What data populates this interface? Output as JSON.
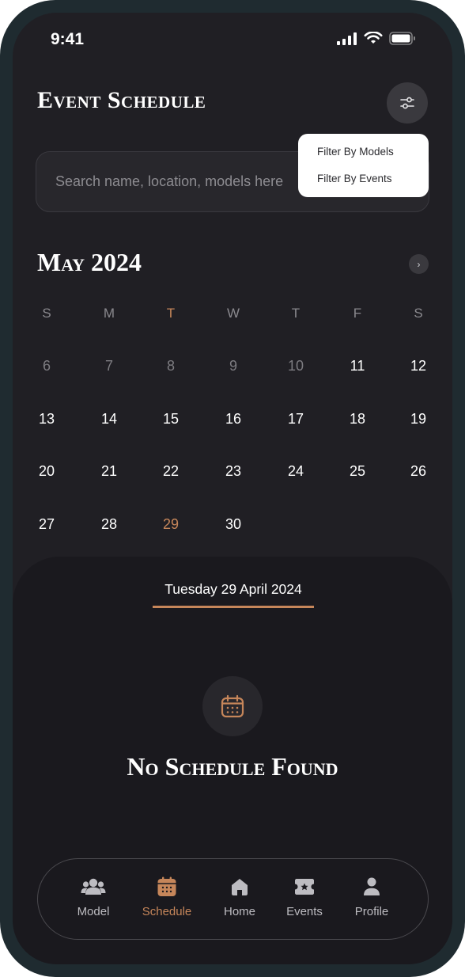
{
  "status_bar": {
    "time": "9:41"
  },
  "header": {
    "title": "Event Schedule"
  },
  "search": {
    "placeholder": "Search name, location, models here"
  },
  "filter_menu": {
    "items": [
      "Filter By Models",
      "Filter By Events"
    ]
  },
  "calendar": {
    "month_label": "May 2024",
    "weekdays": [
      "S",
      "M",
      "T",
      "W",
      "T",
      "F",
      "S"
    ],
    "today_weekday_index": 2,
    "weeks": [
      [
        "6",
        "7",
        "8",
        "9",
        "10",
        "11",
        "12"
      ],
      [
        "13",
        "14",
        "15",
        "16",
        "17",
        "18",
        "19"
      ],
      [
        "20",
        "21",
        "22",
        "23",
        "24",
        "25",
        "26"
      ],
      [
        "27",
        "28",
        "29",
        "30",
        "",
        "",
        ""
      ]
    ],
    "muted_days": [
      "6",
      "7",
      "8",
      "9",
      "10"
    ],
    "selected_day": "29"
  },
  "selected_date_label": "Tuesday 29 April 2024",
  "empty_state": {
    "icon": "calendar-icon",
    "title": "No Schedule Found"
  },
  "bottom_nav": {
    "items": [
      {
        "label": "Model",
        "icon": "users-icon",
        "active": false
      },
      {
        "label": "Schedule",
        "icon": "calendar-icon",
        "active": true
      },
      {
        "label": "Home",
        "icon": "home-icon",
        "active": false
      },
      {
        "label": "Events",
        "icon": "ticket-icon",
        "active": false
      },
      {
        "label": "Profile",
        "icon": "user-icon",
        "active": false
      }
    ]
  },
  "colors": {
    "background": "#201f24",
    "panel": "#1a191e",
    "accent": "#c6865a",
    "text": "#ffffff",
    "muted": "#7d7c81"
  }
}
